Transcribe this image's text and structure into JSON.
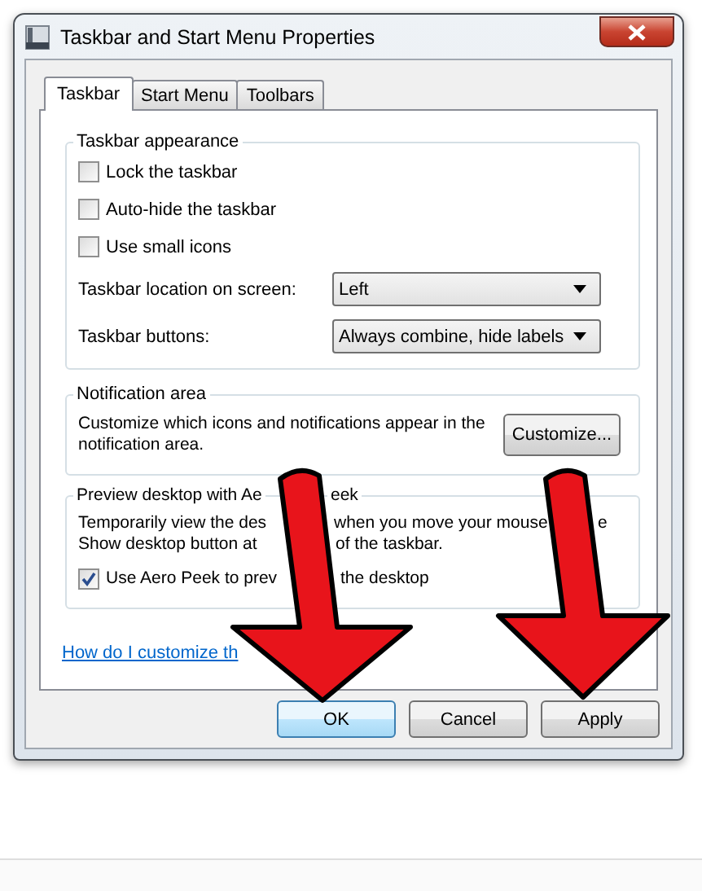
{
  "window": {
    "title": "Taskbar and Start Menu Properties"
  },
  "tabs": [
    {
      "label": "Taskbar",
      "selected": true
    },
    {
      "label": "Start Menu",
      "selected": false
    },
    {
      "label": "Toolbars",
      "selected": false
    }
  ],
  "taskbar_appearance": {
    "title": "Taskbar appearance",
    "options": [
      {
        "label": "Lock the taskbar",
        "checked": false
      },
      {
        "label": "Auto-hide the taskbar",
        "checked": false
      },
      {
        "label": "Use small icons",
        "checked": false
      }
    ],
    "location": {
      "label": "Taskbar location on screen:",
      "value": "Left"
    },
    "taskbar_buttons": {
      "label": "Taskbar buttons:",
      "value": "Always combine, hide labels"
    }
  },
  "notification_area": {
    "title": "Notification area",
    "text": "Customize which icons and notifications appear in the notification area.",
    "button": "Customize..."
  },
  "preview": {
    "title_parts": [
      "Preview desktop with Ae",
      "eek"
    ],
    "lines": [
      [
        "Temporarily view the des",
        "when you move your mouse",
        "e"
      ],
      [
        "Show desktop button at",
        "of the taskbar."
      ]
    ],
    "option": {
      "label_parts": [
        "Use Aero Peek to prev",
        "the desktop"
      ],
      "checked": true
    }
  },
  "help_link": "How do I customize th",
  "buttons": [
    {
      "label": "OK",
      "default": true
    },
    {
      "label": "Cancel",
      "default": false
    },
    {
      "label": "Apply",
      "default": false
    }
  ]
}
